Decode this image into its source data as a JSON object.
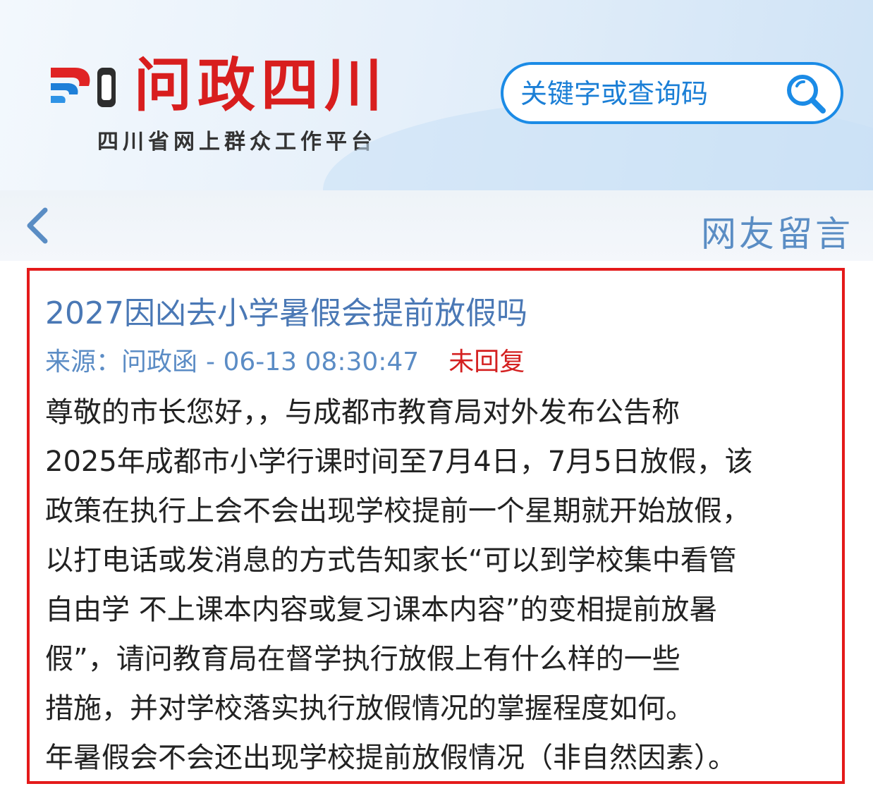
{
  "header": {
    "brand_title": "问政四川",
    "brand_subtitle": "四川省网上群众工作平台",
    "logo_icon": "wenzheng-sichuan-logo-icon",
    "search": {
      "placeholder": "关键字或查询码",
      "icon": "search-icon"
    }
  },
  "nav": {
    "back_icon": "chevron-left-icon",
    "title": "网友留言"
  },
  "post": {
    "title": "2027因凶去小学暑假会提前放假吗",
    "meta": {
      "source_label": "来源：",
      "source": "问政函",
      "time": "- 06-13 08:30:47",
      "status": "未回复"
    },
    "body_lines": [
      "尊敬的市长您好，，与成都市教育局对外发布公告称",
      "2025年成都市小学行课时间至7月4日，7月5日放假，该",
      "政策在执行上会不会出现学校提前一个星期就开始放假，",
      "以打电话或发消息的方式告知家长“可以到学校集中看管",
      "自由学 不上课本内容或复习课本内容”的变相提前放暑",
      "假”，请问教育局在督学执行放假上有什么样的一些",
      "措施，并对学校落实执行放假情况的掌握程度如何。",
      "年暑假会不会还出现学校提前放假情况（非自然因素）。"
    ]
  },
  "colors": {
    "brand_red": "#d81e1e",
    "search_border": "#1b8be6",
    "link_blue": "#5b8cc5",
    "status_red": "#d42020",
    "highlight_frame": "#e41a1a"
  }
}
